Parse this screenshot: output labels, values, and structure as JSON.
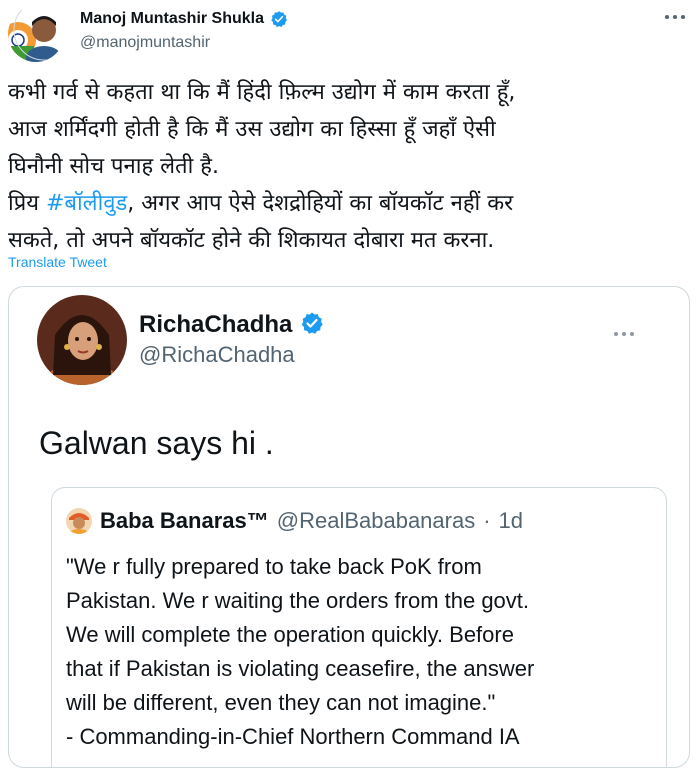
{
  "author": {
    "name": "Manoj Muntashir Shukla",
    "handle": "@manojmuntashir",
    "verified": true
  },
  "tweet": {
    "lines": [
      "कभी गर्व से कहता था कि मैं हिंदी फ़िल्म उद्योग में काम करता हूँ,",
      "आज शर्मिंदगी होती है कि मैं उस उद्योग का हिस्सा हूँ जहाँ ऐसी",
      "घिनौनी सोच पनाह लेती है."
    ],
    "line4_prefix": "प्रिय ",
    "hashtag": "#बॉलीवुड",
    "line4_suffix": ", अगर आप ऐसे देशद्रोहियों का बॉयकॉट नहीं कर",
    "line5": "सकते, तो अपने बॉयकॉट होने की शिकायत दोबारा मत करना."
  },
  "translate_label": "Translate Tweet",
  "quoted": {
    "name": "RichaChadha",
    "handle": "@RichaChadha",
    "verified": true,
    "text": "Galwan says hi .",
    "inner": {
      "name": "Baba Banaras™",
      "handle": "@RealBababanaras",
      "separator": "·",
      "time": "1d",
      "lines": [
        "\"We r fully prepared to take back PoK from",
        "Pakistan. We r waiting the orders from the govt.",
        "We will complete the operation quickly. Before",
        "that if Pakistan is violating ceasefire, the answer",
        "will be different, even they can not imagine.\"",
        "- Commanding-in-Chief Northern Command IA"
      ]
    }
  },
  "icons": {
    "verified": "verified-badge-icon",
    "more": "more-options-icon"
  },
  "colors": {
    "link": "#1d9bf0",
    "secondary_text": "#536471",
    "border": "#cfd9de"
  }
}
